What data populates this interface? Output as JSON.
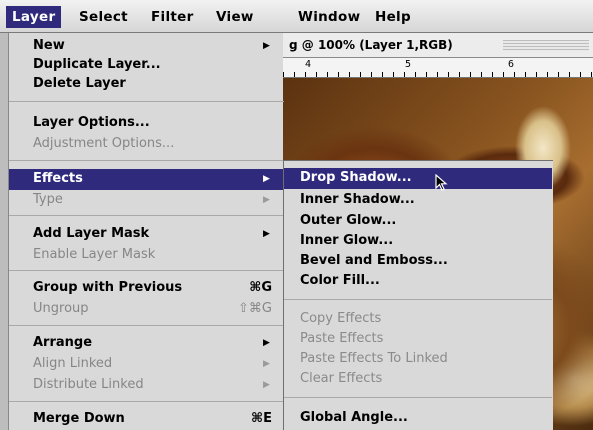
{
  "menubar": {
    "items": [
      {
        "label": "Layer",
        "active": true
      },
      {
        "label": "Select"
      },
      {
        "label": "Filter"
      },
      {
        "label": "View"
      },
      {
        "label": "Window"
      },
      {
        "label": "Help"
      }
    ]
  },
  "document": {
    "title": "g @ 100% (Layer 1,RGB)",
    "ruler_numbers": [
      "4",
      "5",
      "6"
    ]
  },
  "layer_menu": {
    "new": "New",
    "duplicate_layer": "Duplicate Layer...",
    "delete_layer": "Delete Layer",
    "layer_options": "Layer Options...",
    "adjustment_options": "Adjustment Options...",
    "effects": "Effects",
    "type": "Type",
    "add_layer_mask": "Add Layer Mask",
    "enable_layer_mask": "Enable Layer Mask",
    "group_with_previous": "Group with Previous",
    "group_with_previous_shortcut": "⌘G",
    "ungroup": "Ungroup",
    "ungroup_shortcut": "⇧⌘G",
    "arrange": "Arrange",
    "align_linked": "Align Linked",
    "distribute_linked": "Distribute Linked",
    "merge_down": "Merge Down",
    "merge_down_shortcut": "⌘E"
  },
  "effects_submenu": {
    "drop_shadow": "Drop Shadow...",
    "inner_shadow": "Inner Shadow...",
    "outer_glow": "Outer Glow...",
    "inner_glow": "Inner Glow...",
    "bevel_and_emboss": "Bevel and Emboss...",
    "color_fill": "Color Fill...",
    "copy_effects": "Copy Effects",
    "paste_effects": "Paste Effects",
    "paste_effects_to_linked": "Paste Effects To Linked",
    "clear_effects": "Clear Effects",
    "global_angle": "Global Angle..."
  },
  "colors": {
    "highlight": "#2f2a7c",
    "menu_background": "#d9d9d9",
    "disabled_text": "#868686"
  },
  "icons": {
    "submenu_arrow": "triangle-right-icon",
    "pointer": "arrow-cursor-icon"
  }
}
